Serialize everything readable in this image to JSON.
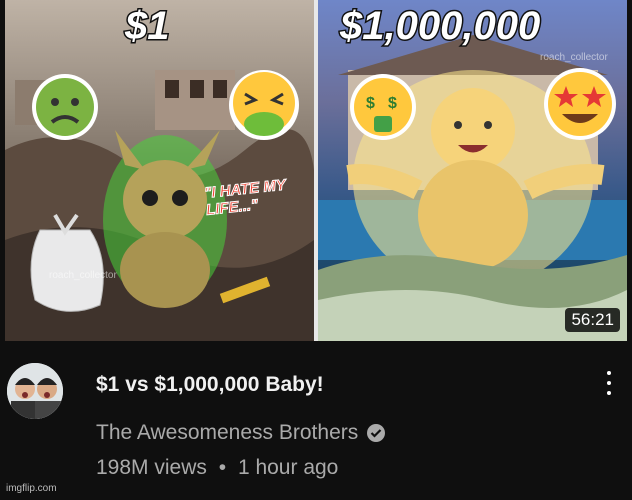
{
  "thumbnail": {
    "left_title": "$1",
    "right_title": "$1,000,000",
    "watermark_left": "roach_collector",
    "watermark_right": "roach_collector",
    "quote": "\"I HATE MY LIFE...\"",
    "duration": "56:21"
  },
  "video": {
    "title": "$1 vs $1,000,000 Baby!",
    "channel": "The Awesomeness Brothers",
    "views": "198M views",
    "separator": "•",
    "age": "1 hour ago"
  },
  "footer": {
    "watermark": "imgflip.com"
  }
}
